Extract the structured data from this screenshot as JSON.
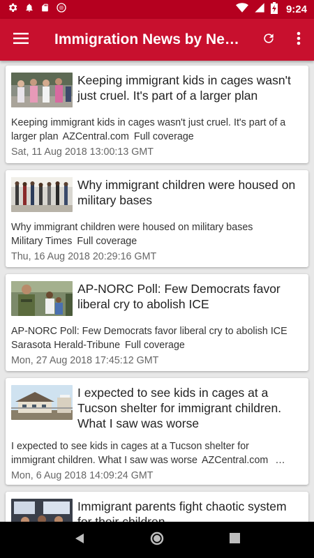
{
  "status_bar": {
    "time": "9:24",
    "icons": [
      "gear-icon",
      "notification-bell-icon",
      "sd-card-icon",
      "sync-circle-icon",
      "wifi-icon",
      "signal-icon",
      "battery-charging-icon"
    ]
  },
  "app_bar": {
    "title": "Immigration News by Ne…",
    "icons": [
      "menu-icon",
      "refresh-icon",
      "more-vert-icon"
    ]
  },
  "colors": {
    "status_bar": "#b5001f",
    "app_bar": "#c8102e",
    "background": "#e8e8e8",
    "card": "#ffffff"
  },
  "articles": [
    {
      "headline": "Keeping immigrant kids in cages wasn't just cruel. It's part of a larger plan",
      "summary": "Keeping immigrant kids in cages wasn't just cruel. It's part of a larger plan",
      "source": "AZCentral.com",
      "coverage": "Full coverage",
      "date": "Sat, 11 Aug 2018 13:00:13 GMT"
    },
    {
      "headline": "Why immigrant children were housed on military bases",
      "summary": "Why immigrant children were housed on military bases",
      "source": "Military Times",
      "coverage": "Full coverage",
      "date": "Thu, 16 Aug 2018 20:29:16 GMT"
    },
    {
      "headline": "AP-NORC Poll: Few Democrats favor liberal cry to abolish ICE",
      "summary": "AP-NORC Poll: Few Democrats favor liberal cry to abolish ICE",
      "source": "Sarasota Herald-Tribune",
      "coverage": "Full coverage",
      "date": "Mon, 27 Aug 2018 17:45:12 GMT"
    },
    {
      "headline": "I expected to see kids in cages at a Tucson shelter for immigrant children. What I saw was worse",
      "summary": "I expected to see kids in cages at a Tucson shelter for immigrant children. What I saw was worse",
      "source": "AZCentral.com",
      "coverage": "…",
      "date": "Mon, 6 Aug 2018 14:09:24 GMT"
    },
    {
      "headline": "Immigrant parents fight chaotic system for their children",
      "summary": "",
      "source": "",
      "coverage": "",
      "date": ""
    }
  ],
  "nav_bar": {
    "icons": [
      "back-icon",
      "home-icon",
      "recents-icon"
    ]
  }
}
